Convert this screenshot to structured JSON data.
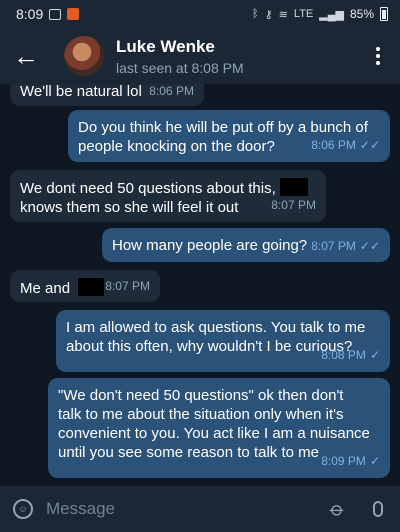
{
  "status_bar": {
    "time": "8:09",
    "network_label": "LTE",
    "battery": "85%"
  },
  "header": {
    "contact_name": "Luke Wenke",
    "last_seen": "last seen at 8:08 PM"
  },
  "messages": [
    {
      "direction": "in",
      "text": "We'll be natural lol",
      "time": "8:06 PM"
    },
    {
      "direction": "out",
      "lines": [
        "Do you think he will be put off by a bunch of",
        "people knocking on the door?"
      ],
      "time": "8:06 PM",
      "status": "read"
    },
    {
      "direction": "in",
      "lines": [
        "We dont need 50 questions about this,",
        "knows them so she will feel it out"
      ],
      "time": "8:07 PM"
    },
    {
      "direction": "out",
      "text": "How many people are going?",
      "time": "8:07 PM",
      "status": "read"
    },
    {
      "direction": "in",
      "text": "Me and",
      "time": "8:07 PM"
    },
    {
      "direction": "out",
      "lines": [
        "I am allowed to ask questions. You talk to me",
        "about this often, why wouldn't I be curious?"
      ],
      "time": "8:08 PM",
      "status": "sent"
    },
    {
      "direction": "out",
      "lines": [
        "\"We don't need 50 questions\" ok then don't",
        "talk to me about the situation only when it's",
        "convenient to you. You act like I am a nuisance",
        "until you see some reason to talk to me"
      ],
      "time": "8:09 PM",
      "status": "sent"
    }
  ],
  "composer": {
    "placeholder": "Message"
  },
  "colors": {
    "background": "#0f1822",
    "bar": "#1b2735",
    "incoming_bubble": "#1e2c3a",
    "outgoing_bubble": "#2b5278",
    "check": "#7eb3e0"
  }
}
